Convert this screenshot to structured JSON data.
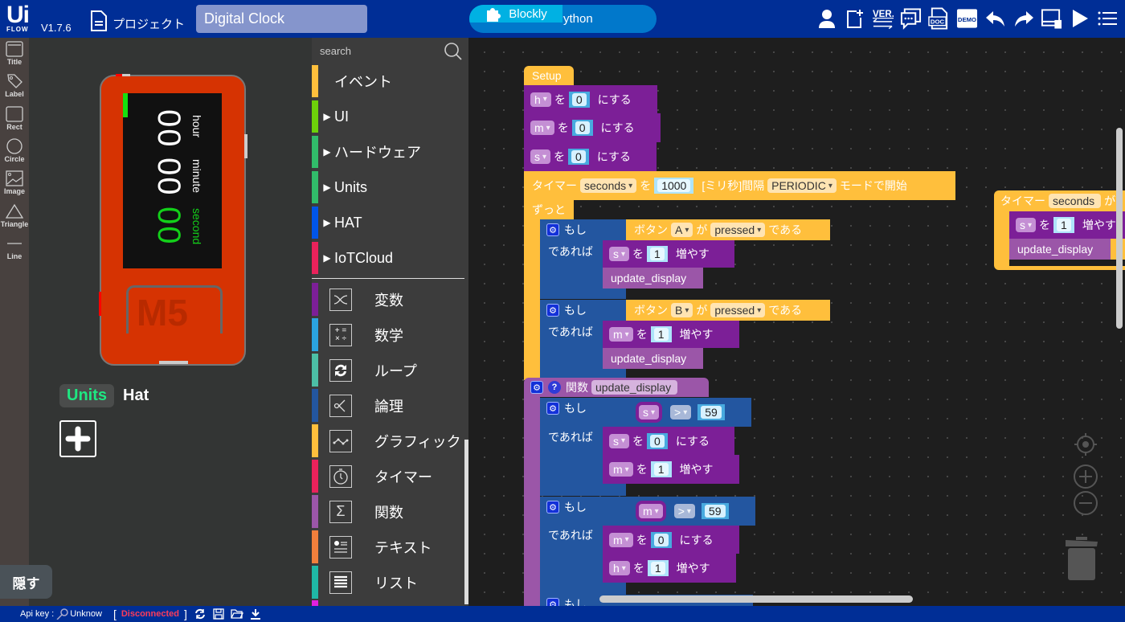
{
  "app": {
    "logo_top": "Ui",
    "logo_bottom": "FLOW",
    "version": "V1.7.6",
    "project_label": "プロジェクト",
    "project_name": "Digital Clock"
  },
  "mode_toggle": {
    "blockly_label": "Blockly",
    "python_label": "Python",
    "active": "Blockly"
  },
  "toolbar_icons": [
    "user-icon",
    "new-file-icon",
    "version-icon",
    "feedback-icon",
    "doc-icon",
    "demo-icon",
    "undo-icon",
    "redo-icon",
    "device-manager-icon",
    "run-icon",
    "menu-icon"
  ],
  "toolbar_text": {
    "ver": "VER.",
    "doc": "DOC",
    "demo": "DEMO"
  },
  "shapes": [
    {
      "icon": "title-icon",
      "label": "Title"
    },
    {
      "icon": "label-icon",
      "label": "Label"
    },
    {
      "icon": "rect-icon",
      "label": "Rect"
    },
    {
      "icon": "circle-icon",
      "label": "Circle"
    },
    {
      "icon": "image-icon",
      "label": "Image"
    },
    {
      "icon": "triangle-icon",
      "label": "Triangle"
    },
    {
      "icon": "line-icon",
      "label": "Line"
    }
  ],
  "device": {
    "hour_value": "00",
    "minute_value": "00",
    "second_value": "00",
    "hour_label": "hour",
    "minute_label": "minute",
    "second_label": "second",
    "brand": "M5"
  },
  "device_tabs": {
    "units": "Units",
    "hat": "Hat"
  },
  "hide_button": "隠す",
  "toolbox": {
    "search_placeholder": "search",
    "categories": [
      {
        "label": "イベント",
        "color": "#ffbf3c",
        "expandable": false
      },
      {
        "label": "UI",
        "color": "#6dd10a",
        "expandable": true
      },
      {
        "label": "ハードウェア",
        "color": "#31bc6a",
        "expandable": true
      },
      {
        "label": "Units",
        "color": "#31bc6a",
        "expandable": true
      },
      {
        "label": "HAT",
        "color": "#0055e8",
        "expandable": true
      },
      {
        "label": "IoTCloud",
        "color": "#e9225b",
        "expandable": true
      }
    ],
    "builtins": [
      {
        "label": "変数",
        "color": "#7c1f97",
        "icon": "shuffle-icon"
      },
      {
        "label": "数学",
        "color": "#2ba4e0",
        "icon": "math-icon"
      },
      {
        "label": "ループ",
        "color": "#4cbfa6",
        "icon": "loop-icon"
      },
      {
        "label": "論理",
        "color": "#2356a0",
        "icon": "logic-icon"
      },
      {
        "label": "グラフィック",
        "color": "#ffbf3c",
        "icon": "graphic-icon"
      },
      {
        "label": "タイマー",
        "color": "#e9225b",
        "icon": "timer-icon"
      },
      {
        "label": "関数",
        "color": "#9b56a8",
        "icon": "sigma-icon"
      },
      {
        "label": "テキスト",
        "color": "#f07f3c",
        "icon": "text-icon"
      },
      {
        "label": "リスト",
        "color": "#1fb8a6",
        "icon": "list-icon"
      }
    ]
  },
  "blocks": {
    "setup": "Setup",
    "set": "を",
    "set_to": "にする",
    "increase": "増やす",
    "var_h": "h",
    "var_m": "m",
    "var_s": "s",
    "zero": "0",
    "one": "1",
    "timer_prefix": "タイマー",
    "timer_name": "seconds",
    "timer_interval": "1000",
    "timer_unit": "[ミリ秒]間隔",
    "timer_mode": "PERIODIC",
    "timer_suffix": "モードで開始",
    "forever": "ずっと",
    "if": "もし",
    "then": "であれば",
    "button_prefix": "ボタン",
    "button_a": "A",
    "button_b": "B",
    "ga": "が",
    "pressed": "pressed",
    "dearu": "である",
    "update_display": "update_display",
    "function_label": "関数",
    "op_gt": ">",
    "fifty_nine": "59",
    "timer_event_prefix": "タイマー",
    "timer_event_name": "seconds",
    "timer_event_suffix": "が"
  },
  "statusbar": {
    "api_key_label": "Api key :",
    "api_key_value": "Unknow",
    "connection_status": "Disconnected",
    "status_color": "#ff3c5a"
  }
}
